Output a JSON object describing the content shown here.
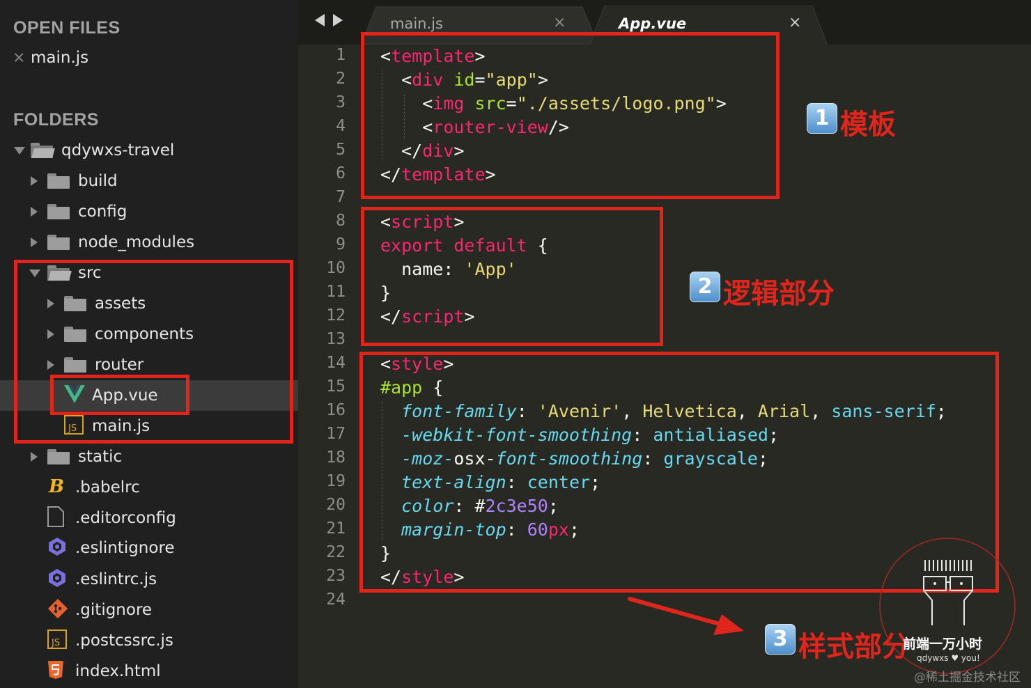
{
  "sidebar": {
    "open_files_header": "OPEN FILES",
    "open_files": [
      {
        "name": "main.js",
        "close": "×"
      }
    ],
    "folders_header": "FOLDERS",
    "tree": [
      {
        "label": "qdywxs-travel",
        "icon": "folder-open-icon"
      },
      {
        "label": "build",
        "icon": "folder-icon"
      },
      {
        "label": "config",
        "icon": "folder-icon"
      },
      {
        "label": "node_modules",
        "icon": "folder-icon"
      },
      {
        "label": "src",
        "icon": "folder-open-icon"
      },
      {
        "label": "assets",
        "icon": "folder-icon"
      },
      {
        "label": "components",
        "icon": "folder-icon"
      },
      {
        "label": "router",
        "icon": "folder-icon"
      },
      {
        "label": "App.vue",
        "icon": "vue-icon",
        "selected": true
      },
      {
        "label": "main.js",
        "icon": "js-file-icon"
      },
      {
        "label": "static",
        "icon": "folder-icon"
      },
      {
        "label": ".babelrc",
        "icon": "babel-icon"
      },
      {
        "label": ".editorconfig",
        "icon": "file-icon"
      },
      {
        "label": ".eslintignore",
        "icon": "eslint-icon"
      },
      {
        "label": ".eslintrc.js",
        "icon": "eslint-icon"
      },
      {
        "label": ".gitignore",
        "icon": "git-icon"
      },
      {
        "label": ".postcssrc.js",
        "icon": "js-file-icon"
      },
      {
        "label": "index.html",
        "icon": "html5-icon"
      }
    ]
  },
  "editor": {
    "tabs": [
      {
        "label": "main.js",
        "active": false,
        "close": "×"
      },
      {
        "label": "App.vue",
        "active": true,
        "close": "×"
      }
    ],
    "line_numbers": [
      "1",
      "2",
      "3",
      "4",
      "5",
      "6",
      "7",
      "8",
      "9",
      "10",
      "11",
      "12",
      "13",
      "14",
      "15",
      "16",
      "17",
      "18",
      "19",
      "20",
      "21",
      "22",
      "23",
      "24"
    ],
    "code_lines": [
      [
        [
          "p",
          "<"
        ],
        [
          "tag",
          "template"
        ],
        [
          "p",
          ">"
        ]
      ],
      [
        [
          "p",
          "  <"
        ],
        [
          "tag",
          "div"
        ],
        [
          "p",
          " "
        ],
        [
          "attr",
          "id"
        ],
        [
          "p",
          "="
        ],
        [
          "str",
          "\"app\""
        ],
        [
          "p",
          ">"
        ]
      ],
      [
        [
          "p",
          "    <"
        ],
        [
          "tag",
          "img"
        ],
        [
          "p",
          " "
        ],
        [
          "attr",
          "src"
        ],
        [
          "p",
          "="
        ],
        [
          "str",
          "\"./assets/logo.png\""
        ],
        [
          "p",
          ">"
        ]
      ],
      [
        [
          "p",
          "    <"
        ],
        [
          "tag",
          "router-view"
        ],
        [
          "p",
          "/>"
        ]
      ],
      [
        [
          "p",
          "  </"
        ],
        [
          "tag",
          "div"
        ],
        [
          "p",
          ">"
        ]
      ],
      [
        [
          "p",
          "</"
        ],
        [
          "tag",
          "template"
        ],
        [
          "p",
          ">"
        ]
      ],
      [],
      [
        [
          "p",
          "<"
        ],
        [
          "tag",
          "script"
        ],
        [
          "p",
          ">"
        ]
      ],
      [
        [
          "kw",
          "export default"
        ],
        [
          "p",
          " {"
        ]
      ],
      [
        [
          "p",
          "  name: "
        ],
        [
          "str",
          "'App'"
        ]
      ],
      [
        [
          "p",
          "}"
        ]
      ],
      [
        [
          "p",
          "</"
        ],
        [
          "tag",
          "script"
        ],
        [
          "p",
          ">"
        ]
      ],
      [],
      [
        [
          "p",
          "<"
        ],
        [
          "tag",
          "style"
        ],
        [
          "p",
          ">"
        ]
      ],
      [
        [
          "id",
          "#app"
        ],
        [
          "p",
          " {"
        ]
      ],
      [
        [
          "p",
          "  "
        ],
        [
          "prop",
          "font-family"
        ],
        [
          "p",
          ": "
        ],
        [
          "str",
          "'Avenir'"
        ],
        [
          "p",
          ", "
        ],
        [
          "str",
          "Helvetica"
        ],
        [
          "p",
          ", "
        ],
        [
          "str",
          "Arial"
        ],
        [
          "p",
          ", "
        ],
        [
          "val",
          "sans-serif"
        ],
        [
          "p",
          ";"
        ]
      ],
      [
        [
          "p",
          "  "
        ],
        [
          "prop",
          "-webkit-font-smoothing"
        ],
        [
          "p",
          ": "
        ],
        [
          "val",
          "antialiased"
        ],
        [
          "p",
          ";"
        ]
      ],
      [
        [
          "p",
          "  "
        ],
        [
          "prop",
          "-moz-"
        ],
        [
          "p",
          "osx-"
        ],
        [
          "prop",
          "font-smoothing"
        ],
        [
          "p",
          ": "
        ],
        [
          "val",
          "grayscale"
        ],
        [
          "p",
          ";"
        ]
      ],
      [
        [
          "p",
          "  "
        ],
        [
          "prop",
          "text-align"
        ],
        [
          "p",
          ": "
        ],
        [
          "val",
          "center"
        ],
        [
          "p",
          ";"
        ]
      ],
      [
        [
          "p",
          "  "
        ],
        [
          "prop",
          "color"
        ],
        [
          "p",
          ": #"
        ],
        [
          "num",
          "2c3e50"
        ],
        [
          "p",
          ";"
        ]
      ],
      [
        [
          "p",
          "  "
        ],
        [
          "prop",
          "margin-top"
        ],
        [
          "p",
          ": "
        ],
        [
          "num",
          "60"
        ],
        [
          "kw",
          "px"
        ],
        [
          "p",
          ";"
        ]
      ],
      [
        [
          "p",
          "}"
        ]
      ],
      [
        [
          "p",
          "</"
        ],
        [
          "tag",
          "style"
        ],
        [
          "p",
          ">"
        ]
      ],
      []
    ]
  },
  "annotations": {
    "template": {
      "num": "1",
      "text": "模板"
    },
    "logic": {
      "num": "2",
      "text": "逻辑部分"
    },
    "style": {
      "num": "3",
      "text": "样式部分"
    }
  },
  "watermark": {
    "title": "前端一万小时",
    "subtitle": "qdywxs ♥ you!",
    "site": "@稀土掘金技术社区"
  },
  "colors": {
    "annotation_red": "#e0251c",
    "sidebar_bg": "#202020",
    "editor_bg": "#282923"
  }
}
